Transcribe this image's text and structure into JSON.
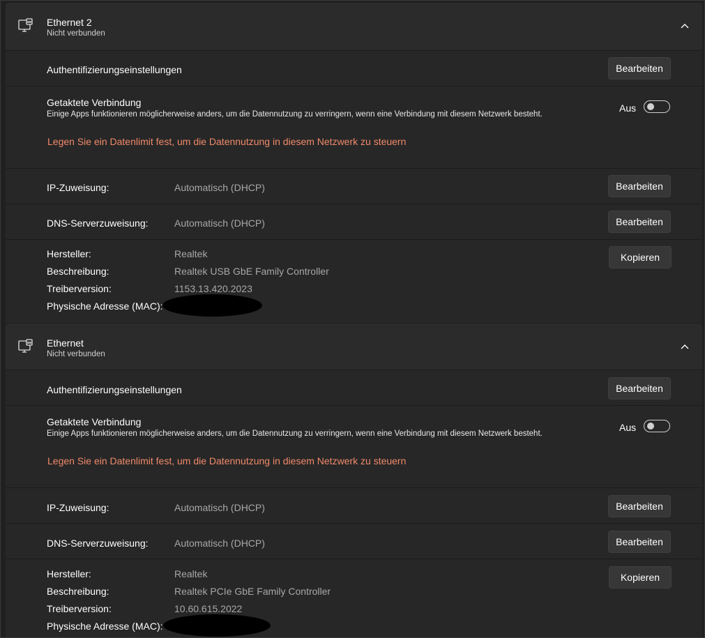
{
  "adapters": [
    {
      "title": "Ethernet 2",
      "status": "Nicht verbunden",
      "auth_label": "Authentifizierungseinstellungen",
      "edit_label": "Bearbeiten",
      "metered_title": "Getaktete Verbindung",
      "metered_desc": "Einige Apps funktionieren möglicherweise anders, um die Datennutzung zu verringern, wenn eine Verbindung mit diesem Netzwerk besteht.",
      "metered_toggle_label": "Aus",
      "metered_on": false,
      "data_limit_link": "Legen Sie ein Datenlimit fest, um die Datennutzung in diesem Netzwerk zu steuern",
      "ip_label": "IP-Zuweisung:",
      "ip_value": "Automatisch (DHCP)",
      "dns_label": "DNS-Serverzuweisung:",
      "dns_value": "Automatisch (DHCP)",
      "manufacturer_label": "Hersteller:",
      "manufacturer_value": "Realtek",
      "description_label": "Beschreibung:",
      "description_value": "Realtek USB GbE Family Controller",
      "driver_label": "Treiberversion:",
      "driver_value": "1153.13.420.2023",
      "mac_label": "Physische Adresse (MAC):",
      "copy_label": "Kopieren"
    },
    {
      "title": "Ethernet",
      "status": "Nicht verbunden",
      "auth_label": "Authentifizierungseinstellungen",
      "edit_label": "Bearbeiten",
      "metered_title": "Getaktete Verbindung",
      "metered_desc": "Einige Apps funktionieren möglicherweise anders, um die Datennutzung zu verringern, wenn eine Verbindung mit diesem Netzwerk besteht.",
      "metered_toggle_label": "Aus",
      "metered_on": false,
      "data_limit_link": "Legen Sie ein Datenlimit fest, um die Datennutzung in diesem Netzwerk zu steuern",
      "ip_label": "IP-Zuweisung:",
      "ip_value": "Automatisch (DHCP)",
      "dns_label": "DNS-Serverzuweisung:",
      "dns_value": "Automatisch (DHCP)",
      "manufacturer_label": "Hersteller:",
      "manufacturer_value": "Realtek",
      "description_label": "Beschreibung:",
      "description_value": "Realtek PCIe GbE Family Controller",
      "driver_label": "Treiberversion:",
      "driver_value": "10.60.615.2022",
      "mac_label": "Physische Adresse (MAC):",
      "copy_label": "Kopieren"
    }
  ],
  "icons": {
    "adapter": "ethernet-adapter-icon",
    "collapse": "chevron-up-icon"
  },
  "colors": {
    "background": "#202020",
    "card": "#272727",
    "header": "#2b2b2b",
    "link": "#f08a6a",
    "secondary_text": "#a8a8a8"
  }
}
